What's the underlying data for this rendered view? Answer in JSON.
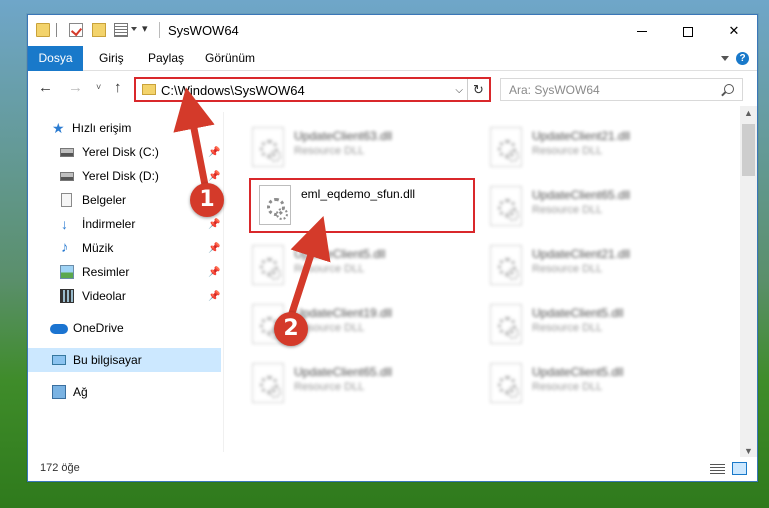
{
  "window": {
    "title": "SysWOW64",
    "quick_access_down": "▾"
  },
  "ribbon": {
    "tabs": [
      {
        "label": "Dosya"
      },
      {
        "label": "Giriş"
      },
      {
        "label": "Paylaş"
      },
      {
        "label": "Görünüm"
      }
    ],
    "help": "?"
  },
  "address_bar": {
    "path": "C:\\Windows\\SysWOW64",
    "refresh_glyph": "↻",
    "dropdown_glyph": "⌵"
  },
  "search": {
    "placeholder": "Ara: SysWOW64"
  },
  "nav_buttons": {
    "back": "←",
    "forward": "→",
    "recent": "˅",
    "up": "↑"
  },
  "sidebar": {
    "items": [
      {
        "label": "Hızlı erişim",
        "icon": "quick-access-star-icon"
      },
      {
        "label": "Yerel Disk (C:)",
        "icon": "disk-icon",
        "pinned": true
      },
      {
        "label": "Yerel Disk (D:)",
        "icon": "disk-icon",
        "pinned": true
      },
      {
        "label": "Belgeler",
        "icon": "documents-icon",
        "pinned": true
      },
      {
        "label": "İndirmeler",
        "icon": "downloads-icon",
        "pinned": true
      },
      {
        "label": "Müzik",
        "icon": "music-icon",
        "pinned": true
      },
      {
        "label": "Resimler",
        "icon": "pictures-icon",
        "pinned": true
      },
      {
        "label": "Videolar",
        "icon": "videos-icon",
        "pinned": true
      },
      {
        "label": "OneDrive",
        "icon": "onedrive-icon"
      },
      {
        "label": "Bu bilgisayar",
        "icon": "this-pc-icon",
        "selected": true
      },
      {
        "label": "Ağ",
        "icon": "network-icon"
      }
    ],
    "pin_glyph": "📌"
  },
  "files": {
    "highlighted": {
      "name": "eml_eqdemo_sfun.dll"
    },
    "left_column": [
      {
        "name": "UpdateClient63.dll",
        "type": "Resource DLL"
      },
      {
        "name": "UpdateClient5.dll",
        "type": "Resource DLL"
      },
      {
        "name": "UpdateClient19.dll",
        "type": "Resource DLL"
      },
      {
        "name": "UpdateClient65.dll",
        "type": "Resource DLL"
      }
    ],
    "right_column": [
      {
        "name": "UpdateClient21.dll",
        "type": "Resource DLL"
      },
      {
        "name": "UpdateClient65.dll",
        "type": "Resource DLL"
      },
      {
        "name": "UpdateClient21.dll",
        "type": "Resource DLL"
      },
      {
        "name": "UpdateClient5.dll",
        "type": "Resource DLL"
      },
      {
        "name": "UpdateClient5.dll",
        "type": "Resource DLL"
      }
    ]
  },
  "status_bar": {
    "item_count": "172 öğe"
  },
  "annotations": {
    "step1": "1",
    "step2": "2",
    "color": "#d43a2a"
  },
  "colors": {
    "accent": "#1979ca",
    "highlight_border": "#d9282b",
    "selection": "#cce8ff"
  }
}
